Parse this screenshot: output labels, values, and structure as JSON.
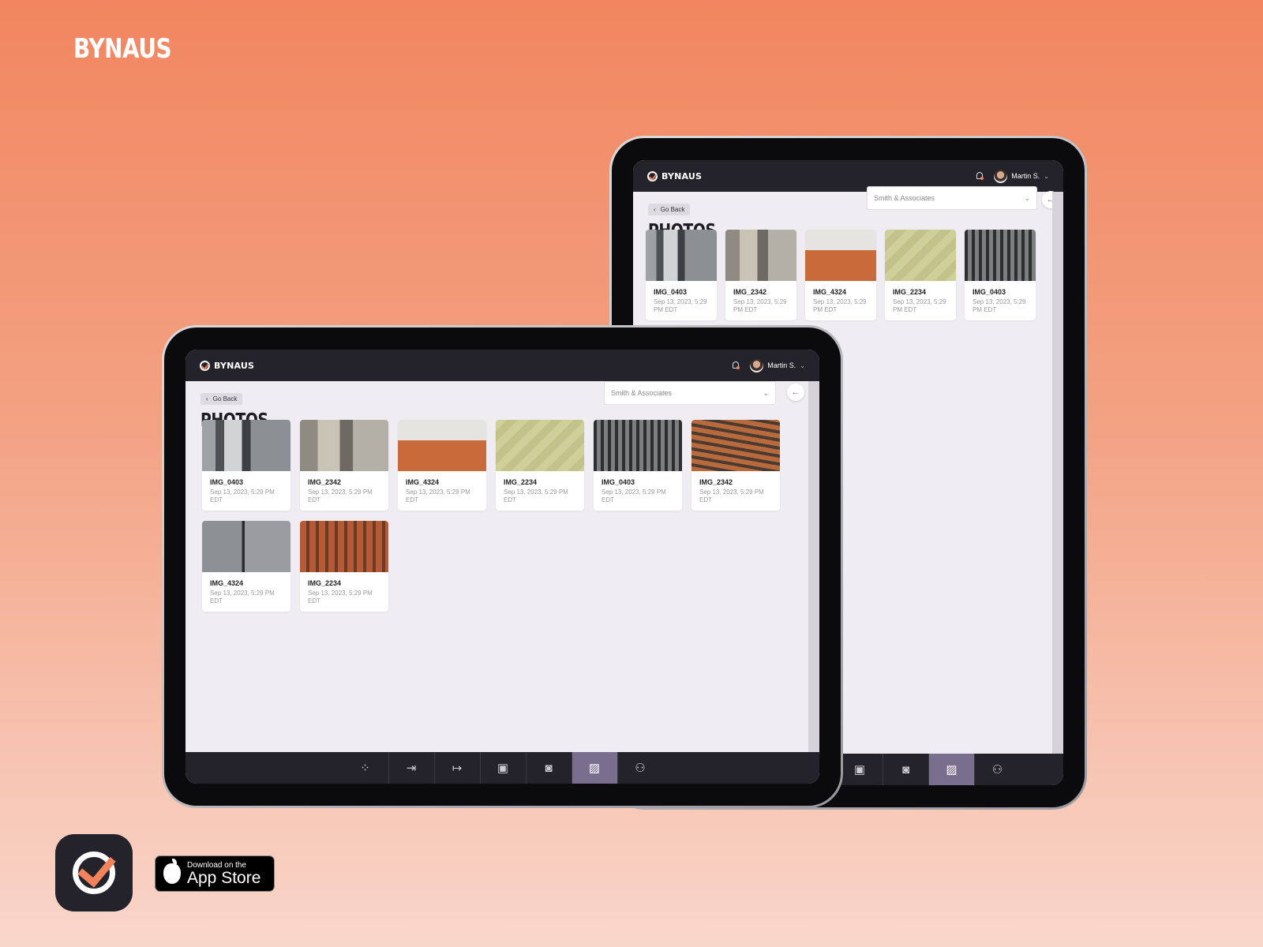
{
  "brand": "BYNAUS",
  "app": {
    "logo_text": "BYNAUS",
    "user_name": "Martin S.",
    "go_back": "Go Back",
    "page_title": "PHOTOS",
    "company_select": "Smith & Associates"
  },
  "photos": [
    {
      "name": "IMG_0403",
      "date": "Sep 13, 2023, 5:29 PM EDT"
    },
    {
      "name": "IMG_2342",
      "date": "Sep 13, 2023, 5:29 PM EDT"
    },
    {
      "name": "IMG_4324",
      "date": "Sep 13, 2023, 5:29 PM EDT"
    },
    {
      "name": "IMG_2234",
      "date": "Sep 13, 2023, 5:29 PM EDT"
    },
    {
      "name": "IMG_0403",
      "date": "Sep 13, 2023, 5:29 PM EDT"
    },
    {
      "name": "IMG_2342",
      "date": "Sep 13, 2023, 5:29 PM EDT"
    },
    {
      "name": "IMG_4324",
      "date": "Sep 13, 2023, 5:29 PM EDT"
    },
    {
      "name": "IMG_2234",
      "date": "Sep 13, 2023, 5:29 PM EDT"
    }
  ],
  "back_photos": [
    {
      "name": "IMG_0403",
      "date": "Sep 13, 2023, 5:29 PM EDT"
    },
    {
      "name": "IMG_2342",
      "date": "Sep 13, 2023, 5:29 PM EDT"
    },
    {
      "name": "IMG_4324",
      "date": "Sep 13, 2023, 5:29 PM EDT"
    },
    {
      "name": "IMG_2234",
      "date": "Sep 13, 2023, 5:29 PM EDT"
    },
    {
      "name": "IMG_0403",
      "date": "Sep 13, 2023, 5:29 PM EDT"
    }
  ],
  "bottom_nav": [
    {
      "icon": "dashboard-icon",
      "glyph": "⁘"
    },
    {
      "icon": "check-in-icon",
      "glyph": "⇥"
    },
    {
      "icon": "check-out-icon",
      "glyph": "↦"
    },
    {
      "icon": "document-icon",
      "glyph": "▣"
    },
    {
      "icon": "camera-icon",
      "glyph": "◙"
    },
    {
      "icon": "photos-icon",
      "glyph": "▨",
      "active": true
    },
    {
      "icon": "add-user-icon",
      "glyph": "⚇"
    }
  ],
  "back_nav": [
    {
      "icon": "document-icon",
      "glyph": "▣"
    },
    {
      "icon": "camera-icon",
      "glyph": "◙"
    },
    {
      "icon": "photos-icon",
      "glyph": "▨",
      "active": true
    },
    {
      "icon": "add-user-icon",
      "glyph": "⚇"
    }
  ],
  "appstore": {
    "small": "Download on the",
    "big": "App Store"
  },
  "colors": {
    "accent": "#f1825c",
    "dark": "#24222a",
    "nav_active": "#7a6e8f"
  }
}
